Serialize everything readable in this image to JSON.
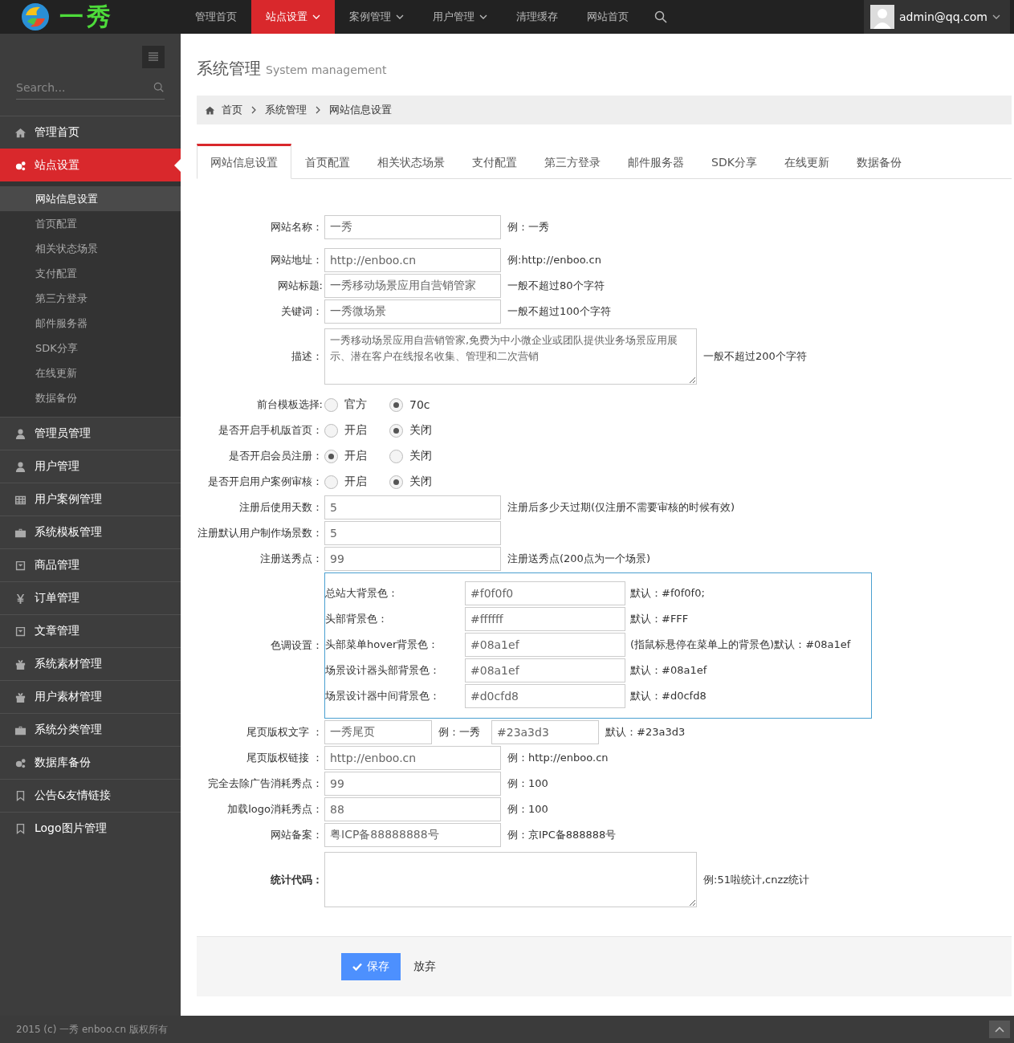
{
  "logo": {
    "text": "一秀"
  },
  "nav": [
    {
      "label": "管理首页",
      "selected": false,
      "dropdown": false
    },
    {
      "label": "站点设置",
      "selected": true,
      "dropdown": true
    },
    {
      "label": "案例管理",
      "selected": false,
      "dropdown": true
    },
    {
      "label": "用户管理",
      "selected": false,
      "dropdown": true
    },
    {
      "label": "清理缓存",
      "selected": false,
      "dropdown": false
    },
    {
      "label": "网站首页",
      "selected": false,
      "dropdown": false
    }
  ],
  "user": {
    "email": "admin@qq.com"
  },
  "sidebar": {
    "search_placeholder": "Search...",
    "items": [
      {
        "label": "管理首页",
        "selected": false
      },
      {
        "label": "站点设置",
        "selected": true,
        "expanded": true,
        "children": [
          {
            "label": "网站信息设置",
            "selected": true
          },
          {
            "label": "首页配置",
            "selected": false
          },
          {
            "label": "相关状态场景",
            "selected": false
          },
          {
            "label": "支付配置",
            "selected": false
          },
          {
            "label": "第三方登录",
            "selected": false
          },
          {
            "label": "邮件服务器",
            "selected": false
          },
          {
            "label": "SDK分享",
            "selected": false
          },
          {
            "label": "在线更新",
            "selected": false
          },
          {
            "label": "数据备份",
            "selected": false
          }
        ]
      },
      {
        "label": "管理员管理",
        "selected": false
      },
      {
        "label": "用户管理",
        "selected": false
      },
      {
        "label": "用户案例管理",
        "selected": false
      },
      {
        "label": "系统模板管理",
        "selected": false
      },
      {
        "label": "商品管理",
        "selected": false
      },
      {
        "label": "订单管理",
        "selected": false
      },
      {
        "label": "文章管理",
        "selected": false
      },
      {
        "label": "系统素材管理",
        "selected": false
      },
      {
        "label": "用户素材管理",
        "selected": false
      },
      {
        "label": "系统分类管理",
        "selected": false
      },
      {
        "label": "数据库备份",
        "selected": false
      },
      {
        "label": "公告&友情链接",
        "selected": false
      },
      {
        "label": "Logo图片管理",
        "selected": false
      }
    ],
    "copyright": "2015 (c) 一秀 enboo.cn 版权所有"
  },
  "page": {
    "title": "系统管理",
    "subtitle": "System management"
  },
  "breadcrumb": [
    "首页",
    "系统管理",
    "网站信息设置"
  ],
  "tabs": [
    {
      "label": "网站信息设置",
      "selected": true
    },
    {
      "label": "首页配置",
      "selected": false
    },
    {
      "label": "相关状态场景",
      "selected": false
    },
    {
      "label": "支付配置",
      "selected": false
    },
    {
      "label": "第三方登录",
      "selected": false
    },
    {
      "label": "邮件服务器",
      "selected": false
    },
    {
      "label": "SDK分享",
      "selected": false
    },
    {
      "label": "在线更新",
      "selected": false
    },
    {
      "label": "数据备份",
      "selected": false
    }
  ],
  "form": [
    {
      "kind": "text",
      "label": "网站名称：",
      "value": "一秀",
      "hint": "例：一秀"
    },
    {
      "kind": "text",
      "label": "网站地址：",
      "value": "http://enboo.cn",
      "hint": "例:http://enboo.cn"
    },
    {
      "kind": "text",
      "label": "网站标题:",
      "value": "一秀移动场景应用自营销管家",
      "hint": "一般不超过80个字符"
    },
    {
      "kind": "text",
      "label": "关键词：",
      "value": "一秀微场景",
      "hint": "一般不超过100个字符"
    },
    {
      "kind": "textarea",
      "label": "描述：",
      "value": "一秀移动场景应用自营销管家,免费为中小微企业或团队提供业务场景应用展示、潜在客户在线报名收集、管理和二次营销",
      "hint": "一般不超过200个字符"
    },
    {
      "kind": "radio",
      "label": "前台模板选择:",
      "options": [
        {
          "label": "官方",
          "selected": false
        },
        {
          "label": "70c",
          "selected": true
        }
      ]
    },
    {
      "kind": "radio",
      "label": "是否开启手机版首页：",
      "options": [
        {
          "label": "开启",
          "selected": false
        },
        {
          "label": "关闭",
          "selected": true
        }
      ]
    },
    {
      "kind": "radio",
      "label": "是否开启会员注册：",
      "options": [
        {
          "label": "开启",
          "selected": true
        },
        {
          "label": "关闭",
          "selected": false
        }
      ]
    },
    {
      "kind": "radio",
      "label": "是否开启用户案例审核：",
      "options": [
        {
          "label": "开启",
          "selected": false
        },
        {
          "label": "关闭",
          "selected": true
        }
      ]
    },
    {
      "kind": "text",
      "label": "注册后使用天数：",
      "value": "5",
      "hint": "注册后多少天过期(仅注册不需要审核的时候有效)"
    },
    {
      "kind": "text",
      "label": "注册默认用户制作场景数：",
      "value": "5"
    },
    {
      "kind": "text",
      "label": "注册送秀点：",
      "value": "99",
      "hint": "注册送秀点(200点为一个场景)"
    },
    {
      "kind": "colors",
      "label": "色调设置：",
      "rows": [
        {
          "label": "总站大背景色：",
          "value": "#f0f0f0",
          "hint": "默认：#f0f0f0;"
        },
        {
          "label": "头部背景色：",
          "value": "#ffffff",
          "hint": "默认：#FFF"
        },
        {
          "label": "头部菜单hover背景色：",
          "value": "#08a1ef",
          "hint": "(指鼠标悬停在菜单上的背景色)默认：#08a1ef"
        },
        {
          "label": "场景设计器头部背景色：",
          "value": "#08a1ef",
          "hint": "默认：#08a1ef"
        },
        {
          "label": "场景设计器中间背景色：",
          "value": "#d0cfd8",
          "hint": "默认：#d0cfd8"
        }
      ]
    },
    {
      "kind": "pair",
      "label": "尾页版权文字 ：",
      "value": "一秀尾页",
      "hint": "例：一秀",
      "value2": "#23a3d3",
      "hint2": "默认：#23a3d3"
    },
    {
      "kind": "text",
      "label": "尾页版权链接 ：",
      "value": "http://enboo.cn",
      "hint": "例：http://enboo.cn"
    },
    {
      "kind": "text",
      "label": "完全去除广告消耗秀点：",
      "value": "99",
      "hint": "例：100"
    },
    {
      "kind": "text",
      "label": "加载logo消耗秀点：",
      "value": "88",
      "hint": "例：100"
    },
    {
      "kind": "text",
      "label": "网站备案：",
      "value": "粤ICP备88888888号",
      "hint": "例：京IPC备888888号"
    },
    {
      "kind": "code",
      "label": "统计代码：",
      "hint": "例:51啦统计,cnzz统计"
    }
  ],
  "actions": {
    "save": "保存",
    "cancel": "放弃"
  }
}
